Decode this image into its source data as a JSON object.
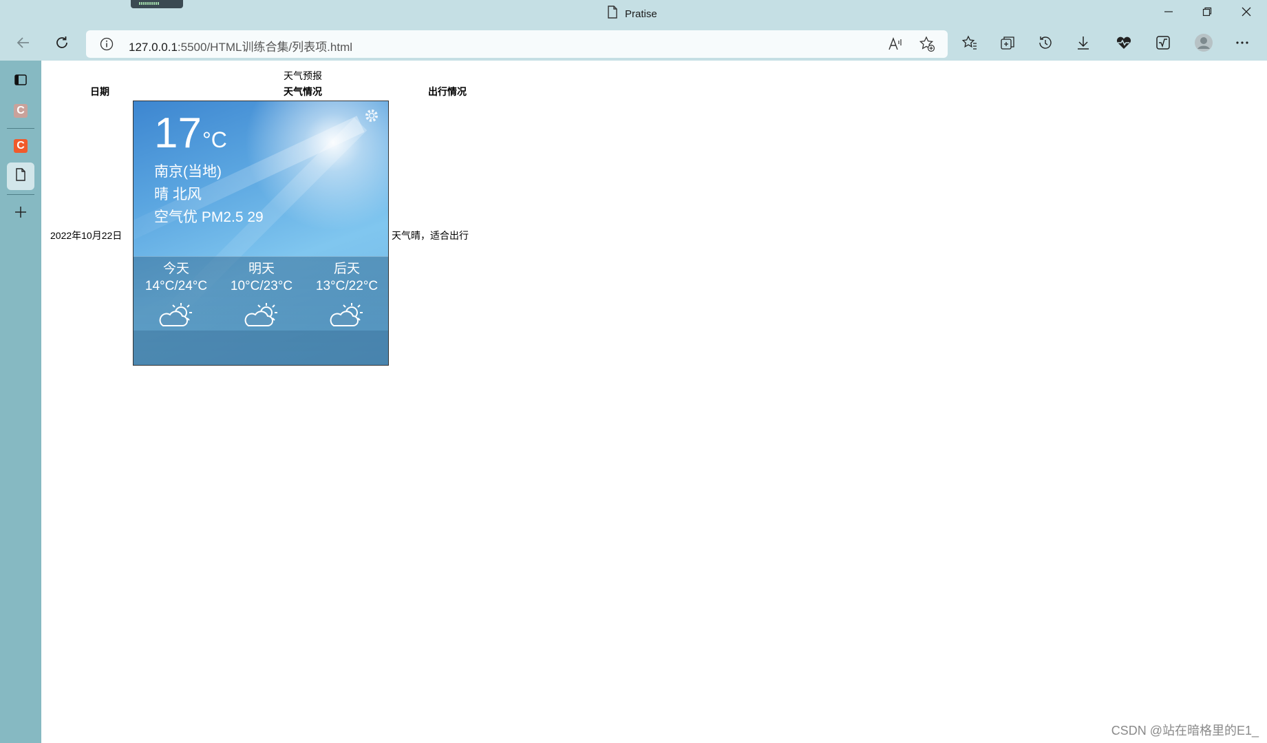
{
  "window": {
    "title": "Pratise",
    "icons": {
      "minimize": "minimize-icon",
      "restore": "restore-icon",
      "close": "close-icon",
      "page": "page-icon"
    }
  },
  "toolbar": {
    "url_host": "127.0.0.1",
    "url_rest": ":5500/HTML训练合集/列表项.html",
    "icons": [
      "back-icon",
      "refresh-icon",
      "info-icon",
      "read-aloud-icon",
      "add-favorite-icon",
      "favorites-icon",
      "collections-icon",
      "history-icon",
      "downloads-icon",
      "performance-icon",
      "math-solver-icon",
      "profile-icon",
      "more-icon"
    ]
  },
  "sidebar": {
    "badge_letter": "C",
    "badge_colors": [
      "#c9a29b",
      "#f15a2b"
    ],
    "icons": [
      "tabs-icon",
      "csdn-tab-icon",
      "csdn-tab-icon",
      "page-icon",
      "add-icon"
    ]
  },
  "table": {
    "caption": "天气预报",
    "headers": [
      "日期",
      "天气情况",
      "出行情况"
    ],
    "date": "2022年10月22日",
    "travel": "天气晴，适合出行"
  },
  "weather": {
    "temperature": "17",
    "unit": "°C",
    "city": "南京(当地)",
    "condition": "晴 北风",
    "air": "空气优 PM2.5 29",
    "forecast": [
      {
        "day": "今天",
        "range": "14°C/24°C",
        "icon": "partly-cloudy-icon"
      },
      {
        "day": "明天",
        "range": "10°C/23°C",
        "icon": "partly-cloudy-icon"
      },
      {
        "day": "后天",
        "range": "13°C/22°C",
        "icon": "partly-cloudy-icon"
      }
    ],
    "settings_icon": "gear-icon"
  },
  "watermark": "CSDN @站在暗格里的E1_"
}
